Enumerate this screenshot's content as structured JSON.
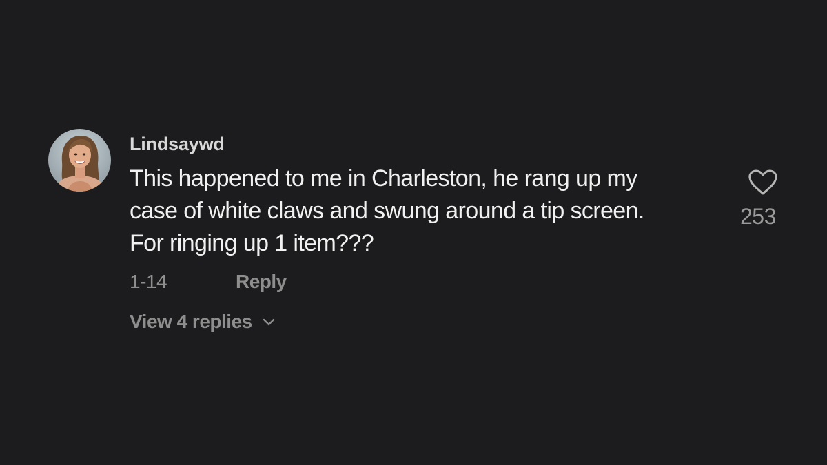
{
  "comment": {
    "username": "Lindsaywd",
    "text_lines": [
      "This happened to me in Charleston, he rang up my",
      "case of white claws and swung around a tip screen.",
      "For ringing up 1 item???"
    ],
    "date": "1-14",
    "reply_label": "Reply",
    "view_replies_label": "View 4 replies",
    "like_count": "253"
  },
  "icons": {
    "like": "heart-outline-icon",
    "expand": "chevron-down-icon"
  },
  "colors": {
    "background": "#1c1c1e",
    "primary_text": "#f1f1f1",
    "username_text": "#d8d8d8",
    "secondary_text": "#8e8e8e"
  }
}
